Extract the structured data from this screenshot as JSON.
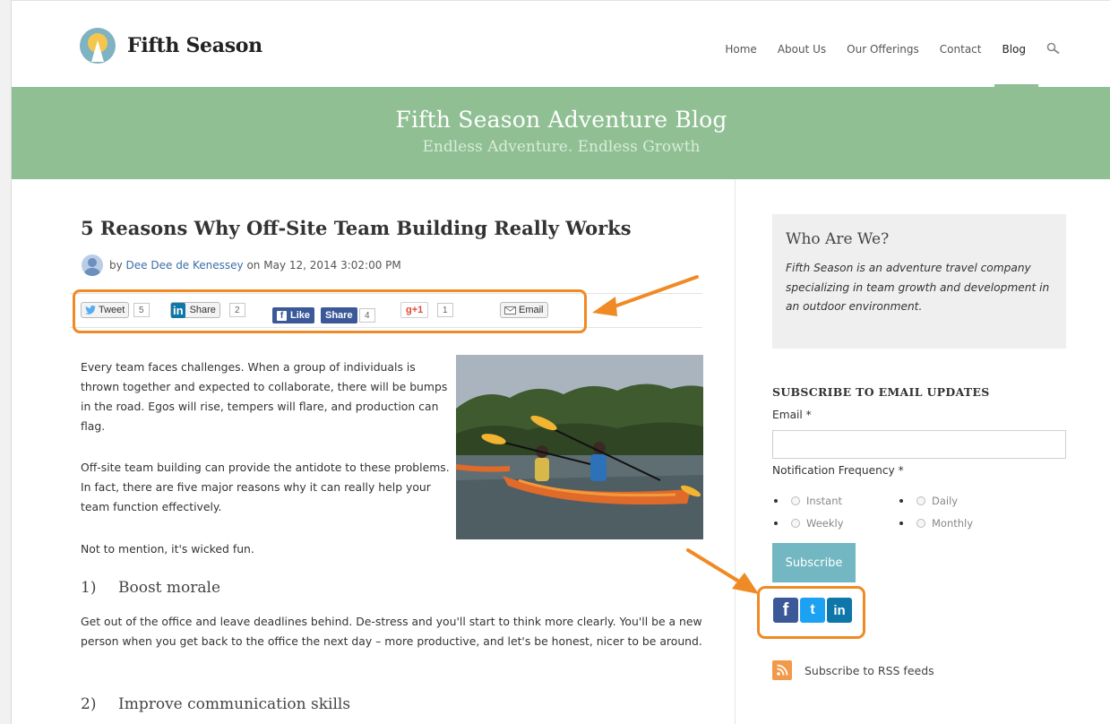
{
  "site": {
    "logo_text": "Fifth Season",
    "nav": [
      "Home",
      "About Us",
      "Our Offerings",
      "Contact",
      "Blog"
    ],
    "active_nav": "Blog"
  },
  "banner": {
    "title": "Fifth Season Adventure Blog",
    "subtitle": "Endless Adventure. Endless Growth"
  },
  "post": {
    "title": "5 Reasons Why Off-Site Team Building Really Works",
    "by": "by",
    "author": "Dee Dee de Kenessey",
    "date": "on May 12, 2014 3:02:00 PM",
    "share": {
      "tweet_label": "Tweet",
      "tweet_count": "5",
      "linkedin_logo": "in",
      "linkedin_label": "Share",
      "linkedin_count": "2",
      "fb_like_label": "Like",
      "fb_share_label": "Share",
      "fb_count": "4",
      "gplus_label": "g+1",
      "gplus_count": "1",
      "email_label": "Email"
    },
    "paragraphs": [
      "Every team faces challenges.  When a group of individuals is thrown together and expected to collaborate, there will be bumps in the road.  Egos will rise, tempers will flare, and production can flag.",
      "Off-site team building can provide the antidote to these problems.  In fact, there are five major reasons why it can really help your team function effectively.",
      "Not to mention, it's wicked fun."
    ],
    "sections": [
      {
        "num": "1)",
        "title": "Boost morale",
        "text": "Get out of the office and leave deadlines behind.  De-stress and you'll start to think more clearly.  You'll be a new person when you get back to the office the next day – more productive, and let's be honest, nicer to be around."
      },
      {
        "num": "2)",
        "title": "Improve communication skills"
      }
    ]
  },
  "sidebar": {
    "who_title": "Who Are We?",
    "who_text": "Fifth Season is an adventure travel company specializing in team growth and development in an outdoor environment.",
    "subscribe_title": "SUBSCRIBE TO EMAIL UPDATES",
    "email_label": "Email *",
    "email_value": "",
    "frequency_label": "Notification Frequency *",
    "frequency_options": [
      "Instant",
      "Daily",
      "Weekly",
      "Monthly"
    ],
    "subscribe_button": "Subscribe",
    "social": {
      "facebook": "f",
      "twitter": "t",
      "linkedin": "in"
    },
    "rss_label": "Subscribe to RSS feeds"
  },
  "colors": {
    "banner_green": "#8fbf93",
    "accent_orange": "#f08a24",
    "subscribe_teal": "#72b7c1",
    "facebook_blue": "#3b5998",
    "twitter_blue": "#1da1f2",
    "linkedin_blue": "#0e76a8"
  },
  "icons": [
    "logo-sun-tree-icon",
    "search-icon",
    "avatar-person-icon",
    "twitter-bird-icon",
    "linkedin-icon",
    "facebook-icon",
    "gplus-icon",
    "email-envelope-icon",
    "rss-icon",
    "orange-arrow-annotation"
  ]
}
